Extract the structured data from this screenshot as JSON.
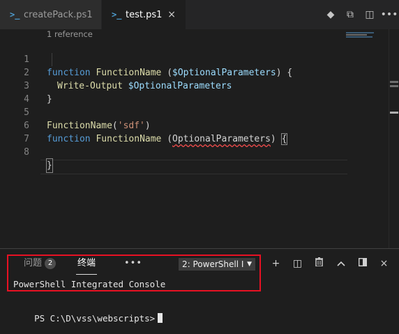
{
  "tabs": [
    {
      "label": "createPack.ps1",
      "icon": "powershell-icon",
      "active": false
    },
    {
      "label": "test.ps1",
      "icon": "powershell-icon",
      "active": true,
      "close": "×"
    }
  ],
  "editor_actions": [
    "git-compare-icon",
    "open-preview-icon",
    "split-editor-icon",
    "more-icon"
  ],
  "codelens": "1 reference",
  "lines": [
    {
      "n": "1"
    },
    {
      "n": "2"
    },
    {
      "n": "3"
    },
    {
      "n": "4"
    },
    {
      "n": "5"
    },
    {
      "n": "6"
    },
    {
      "n": "7"
    },
    {
      "n": "8"
    }
  ],
  "code": {
    "l1": {
      "kw": "function",
      "fn": "FunctionName",
      "p1": " (",
      "var": "$OptionalParameters",
      "p2": ") {"
    },
    "l2": {
      "cmd": "Write-Output",
      "sp": " ",
      "var": "$OptionalParameters"
    },
    "l3": {
      "text": "}"
    },
    "l5": {
      "fn": "FunctionName",
      "p1": "(",
      "str": "'sdf'",
      "p2": ")"
    },
    "l6": {
      "kw": "function",
      "fn": "FunctionName",
      "p1": " (",
      "err": "OptionalParameters",
      "p2": ") ",
      "brace": "{"
    },
    "l8": {
      "text": "}"
    }
  },
  "panel": {
    "problems_label": "问题",
    "problems_count": "2",
    "terminal_label": "终端",
    "more_label": "•••",
    "terminal_select": "2: PowerShell I",
    "select_caret": "▼",
    "actions": {
      "add": "+",
      "split": "◫",
      "trash": "🗑",
      "maximize": "^",
      "layout": "▯",
      "close": "×"
    },
    "console_title": "PowerShell Integrated Console",
    "prompt": "PS C:\\D\\vss\\webscripts>"
  },
  "colors": {
    "accent": "#569cd6",
    "highlight_box": "#e81123",
    "background": "#1e1e1e"
  }
}
